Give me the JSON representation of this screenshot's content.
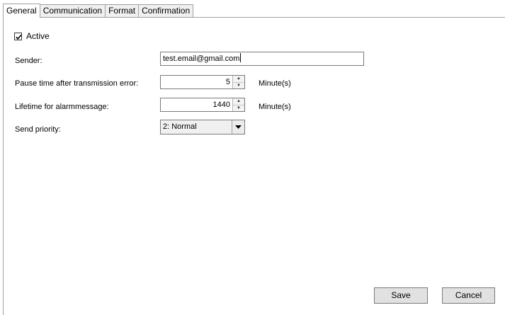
{
  "tabs": [
    {
      "label": "General",
      "active": true
    },
    {
      "label": "Communication",
      "active": false
    },
    {
      "label": "Format",
      "active": false
    },
    {
      "label": "Confirmation",
      "active": false
    }
  ],
  "general": {
    "active": {
      "label": "Active",
      "checked": true
    },
    "sender": {
      "label": "Sender:",
      "value": "test.email@gmail.com"
    },
    "pause_time": {
      "label": "Pause time after transmission error:",
      "value": "5",
      "unit": "Minute(s)"
    },
    "lifetime": {
      "label": "Lifetime for alarmmessage:",
      "value": "1440",
      "unit": "Minute(s)"
    },
    "send_priority": {
      "label": "Send priority:",
      "value": "2: Normal"
    }
  },
  "buttons": {
    "save": "Save",
    "cancel": "Cancel"
  },
  "icons": {
    "check": "check-icon",
    "spin_up": "arrow-up-icon",
    "spin_down": "arrow-down-icon",
    "dropdown": "chevron-down-icon"
  }
}
